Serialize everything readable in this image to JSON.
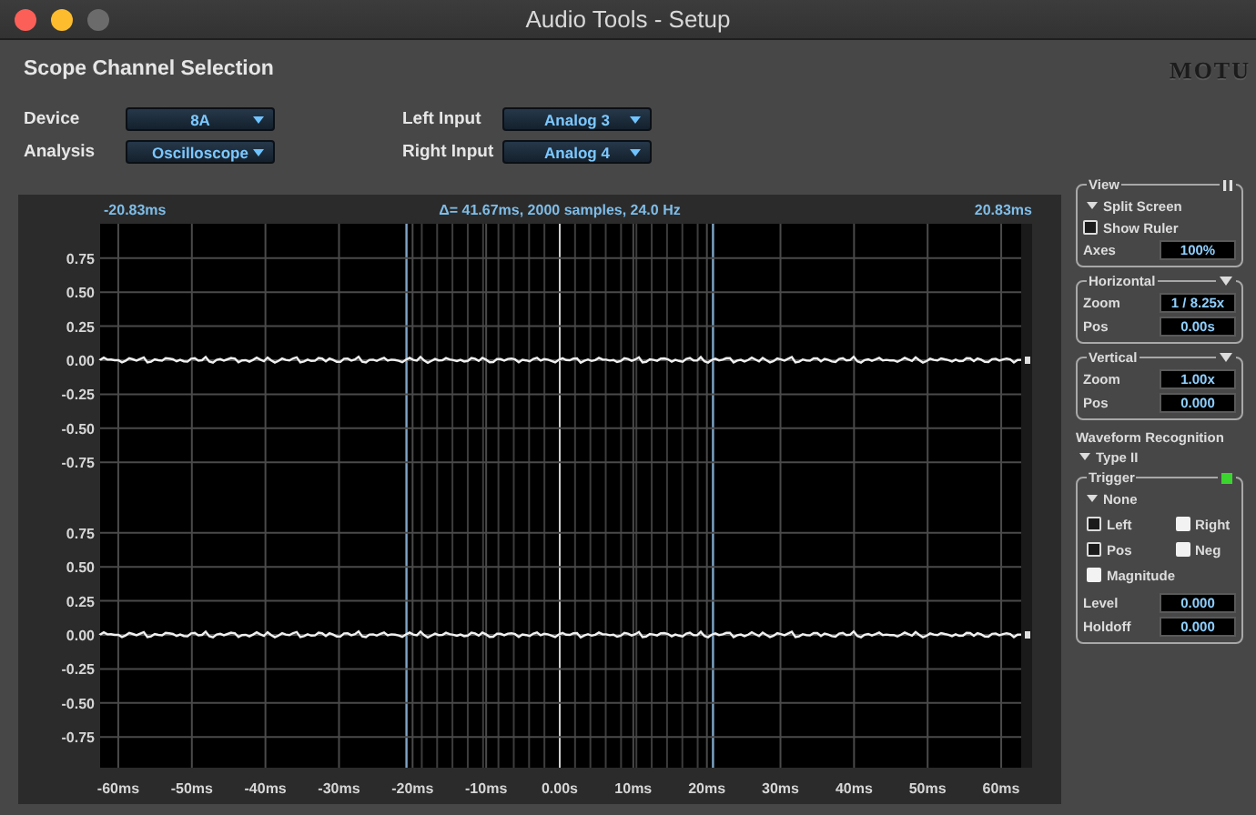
{
  "window": {
    "title": "Audio Tools - Setup",
    "buttons": [
      {
        "kind": "close",
        "disabled": false
      },
      {
        "kind": "minimize",
        "disabled": false
      },
      {
        "kind": "zoom",
        "disabled": true
      }
    ]
  },
  "header": {
    "title": "Scope Channel Selection",
    "logo": "MOTU",
    "selectors": [
      {
        "label": "Device",
        "value": "8A"
      },
      {
        "label": "Left Input",
        "value": "Analog 3"
      },
      {
        "label": "Analysis",
        "value": "Oscilloscope"
      },
      {
        "label": "Right Input",
        "value": "Analog 4"
      }
    ]
  },
  "scope": {
    "cursor_left": "-20.83ms",
    "info": "Δ= 41.67ms, 2000 samples, 24.0 Hz",
    "cursor_right": "20.83ms",
    "channels": [
      {
        "y_ticks": [
          "0.75",
          "0.50",
          "0.25",
          "0.00",
          "-0.25",
          "-0.50",
          "-0.75"
        ]
      },
      {
        "y_ticks": [
          "0.75",
          "0.50",
          "0.25",
          "0.00",
          "-0.25",
          "-0.50",
          "-0.75"
        ]
      }
    ],
    "x_ticks": [
      "-60ms",
      "-50ms",
      "-40ms",
      "-30ms",
      "-20ms",
      "-10ms",
      "0.00s",
      "10ms",
      "20ms",
      "30ms",
      "40ms",
      "50ms",
      "60ms"
    ]
  },
  "panel": [
    {
      "kind": "group",
      "title": "View",
      "legend_control": {
        "kind": "pause"
      },
      "items": [
        {
          "kind": "disclosure",
          "label": "Split Screen",
          "expanded": true
        },
        {
          "kind": "checkbox",
          "label": "Show Ruler",
          "checked": false
        },
        {
          "kind": "field",
          "label": "Axes",
          "value": "100%"
        }
      ]
    },
    {
      "kind": "group",
      "title": "Horizontal",
      "legend_control": {
        "kind": "menu"
      },
      "items": [
        {
          "kind": "field",
          "label": "Zoom",
          "value": "1 / 8.25x"
        },
        {
          "kind": "field",
          "label": "Pos",
          "value": "0.00s"
        }
      ]
    },
    {
      "kind": "group",
      "title": "Vertical",
      "legend_control": {
        "kind": "menu"
      },
      "items": [
        {
          "kind": "field",
          "label": "Zoom",
          "value": "1.00x"
        },
        {
          "kind": "field",
          "label": "Pos",
          "value": "0.000"
        }
      ]
    },
    {
      "kind": "heading",
      "label": "Waveform Recognition"
    },
    {
      "kind": "disclosure",
      "label": "Type II",
      "expanded": true
    },
    {
      "kind": "group",
      "title": "Trigger",
      "legend_control": {
        "kind": "led"
      },
      "active": true,
      "items": [
        {
          "kind": "disclosure",
          "label": "None",
          "expanded": true
        },
        {
          "kind": "checkboxes",
          "options": [
            {
              "label": "Left",
              "checked": false
            },
            {
              "label": "Right",
              "checked": true
            },
            {
              "label": "Pos",
              "checked": false
            },
            {
              "label": "Neg",
              "checked": true
            },
            {
              "label": "Magnitude",
              "checked": true
            }
          ]
        },
        {
          "kind": "field",
          "label": "Level",
          "value": "0.000"
        },
        {
          "kind": "field",
          "label": "Holdoff",
          "value": "0.000"
        }
      ]
    }
  ]
}
